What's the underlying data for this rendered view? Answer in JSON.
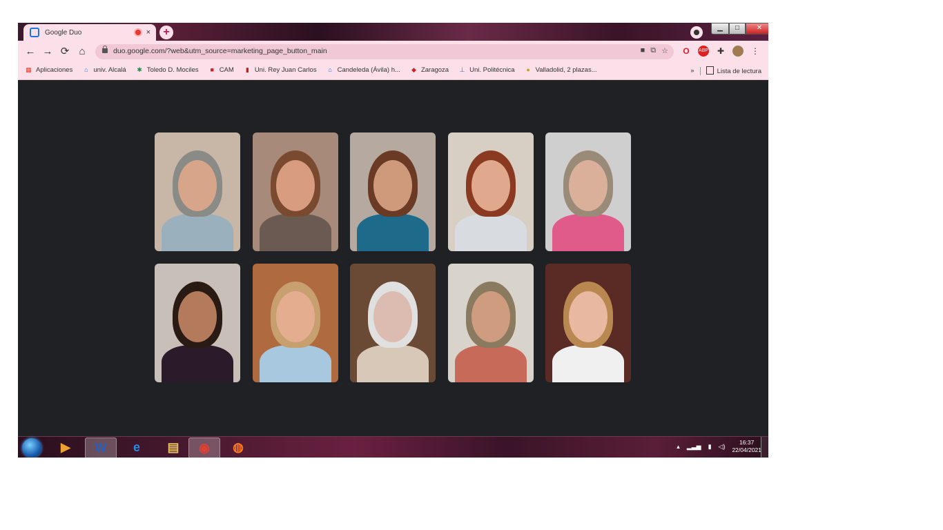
{
  "browser": {
    "tab": {
      "title": "Google Duo",
      "close": "×"
    },
    "new_tab": "+",
    "window_controls": {
      "minimize": "▁",
      "maximize": "□",
      "close": "✕"
    },
    "nav": {
      "back": "←",
      "forward": "→",
      "reload": "⟳",
      "home": "⌂"
    },
    "address_bar": {
      "url": "duo.google.com/?web&utm_source=marketing_page_button_main"
    },
    "bookmarks": [
      {
        "label": "Aplicaciones",
        "icon": "apps-grid-icon"
      },
      {
        "label": "univ. Alcalá",
        "icon": "university-icon"
      },
      {
        "label": "Toledo D. Mociles",
        "icon": "bookmark-icon"
      },
      {
        "label": "CAM",
        "icon": "cam-icon"
      },
      {
        "label": "Uni. Rey Juan Carlos",
        "icon": "university-icon"
      },
      {
        "label": "Candeleda (Ávila) h...",
        "icon": "building-icon"
      },
      {
        "label": "Zaragoza",
        "icon": "shield-icon"
      },
      {
        "label": "Uni. Politécnica",
        "icon": "university-icon"
      },
      {
        "label": "Valladolid, 2 plazas...",
        "icon": "crest-icon"
      }
    ],
    "bookmarks_more": "»",
    "reading_list": "Lista de lectura"
  },
  "call": {
    "participants": [
      {
        "skin": "#d6a58a",
        "hair": "#8a8a86",
        "cloth": "#9ab0bc",
        "bg": "#c8b6a6"
      },
      {
        "skin": "#d89c80",
        "hair": "#7a4a30",
        "cloth": "#6a5a52",
        "bg": "#a88a7a"
      },
      {
        "skin": "#cf9a7c",
        "hair": "#6a3a24",
        "cloth": "#1e6a8a",
        "bg": "#b6aaa0"
      },
      {
        "skin": "#e0a88c",
        "hair": "#8a3a20",
        "cloth": "#d8dce0",
        "bg": "#d8cfc4"
      },
      {
        "skin": "#dab09a",
        "hair": "#9a8a78",
        "cloth": "#e05a8a",
        "bg": "#cfcfd0"
      },
      {
        "skin": "#b47a5c",
        "hair": "#2a1a14",
        "cloth": "#2a1a2a",
        "bg": "#c8c0b8"
      },
      {
        "skin": "#e4ad90",
        "hair": "#c8a070",
        "cloth": "#a8c8e0",
        "bg": "#b06a40"
      },
      {
        "skin": "#dcbcb0",
        "hair": "#e0e0e0",
        "cloth": "#d8c8b8",
        "bg": "#6a4a34"
      },
      {
        "skin": "#d09c80",
        "hair": "#8a7a60",
        "cloth": "#c86a5a",
        "bg": "#d8d4cc"
      },
      {
        "skin": "#e8b8a0",
        "hair": "#b88850",
        "cloth": "#f0f0f0",
        "bg": "#5a2a24"
      }
    ]
  },
  "taskbar": {
    "apps": [
      {
        "name": "media-player-icon",
        "glyph": "▶",
        "color": "#f0a030"
      },
      {
        "name": "word-icon",
        "glyph": "W",
        "color": "#2b5eb8"
      },
      {
        "name": "internet-explorer-icon",
        "glyph": "e",
        "color": "#2a8ae0"
      },
      {
        "name": "file-explorer-icon",
        "glyph": "▤",
        "color": "#e8c060"
      },
      {
        "name": "chrome-icon",
        "glyph": "◉",
        "color": "#e04030"
      },
      {
        "name": "firefox-icon",
        "glyph": "◍",
        "color": "#ff7a20"
      }
    ],
    "clock": {
      "time": "16:37",
      "date": "22/04/2021"
    }
  }
}
